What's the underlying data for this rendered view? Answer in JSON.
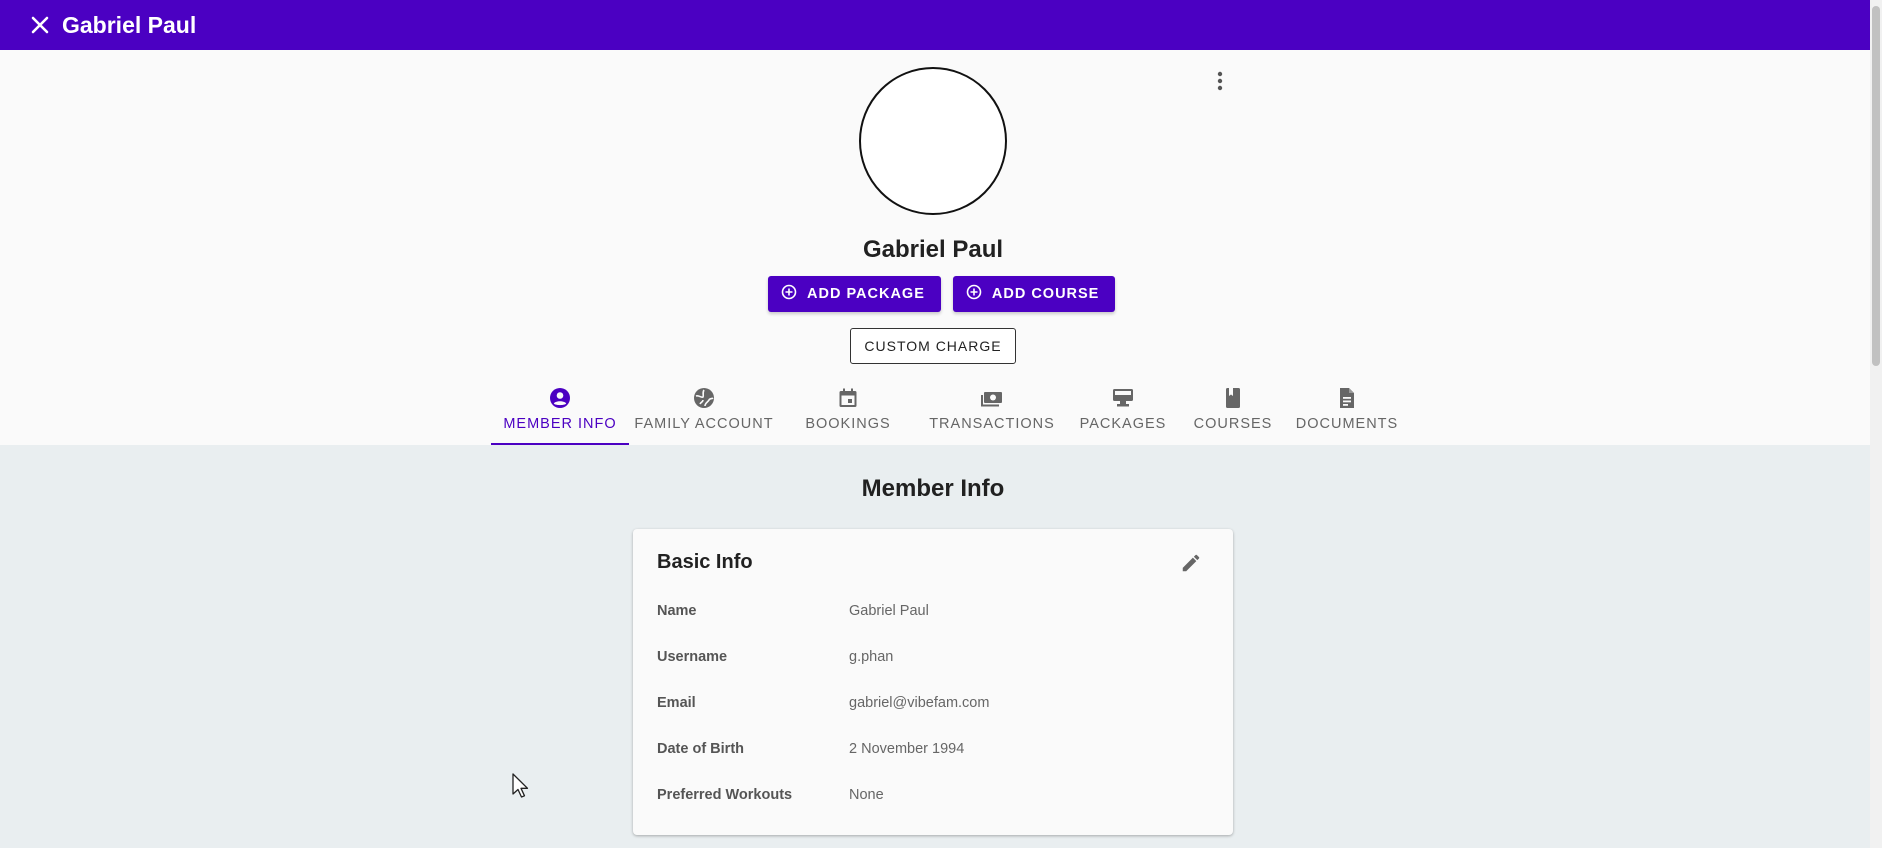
{
  "topbar": {
    "title": "Gabriel Paul",
    "close_icon": "close-icon",
    "bg": "#4b00c2"
  },
  "profile": {
    "name": "Gabriel Paul",
    "add_package_label": "ADD PACKAGE",
    "add_course_label": "ADD COURSE",
    "custom_charge_label": "CUSTOM CHARGE",
    "more_icon": "more-vert-icon"
  },
  "tabs": [
    {
      "label": "MEMBER INFO",
      "icon": "account-circle-icon",
      "active": true
    },
    {
      "label": "FAMILY ACCOUNT",
      "icon": "globe-icon",
      "active": false
    },
    {
      "label": "BOOKINGS",
      "icon": "calendar-icon",
      "active": false
    },
    {
      "label": "TRANSACTIONS",
      "icon": "cash-icon",
      "active": false
    },
    {
      "label": "PACKAGES",
      "icon": "package-icon",
      "active": false
    },
    {
      "label": "COURSES",
      "icon": "book-icon",
      "active": false
    },
    {
      "label": "DOCUMENTS",
      "icon": "document-icon",
      "active": false
    }
  ],
  "member_info": {
    "title": "Member Info",
    "card": {
      "title": "Basic Info",
      "fields": [
        {
          "label": "Name",
          "value": "Gabriel Paul"
        },
        {
          "label": "Username",
          "value": "g.phan"
        },
        {
          "label": "Email",
          "value": "gabriel@vibefam.com"
        },
        {
          "label": "Date of Birth",
          "value": "2 November 1994"
        },
        {
          "label": "Preferred Workouts",
          "value": "None"
        }
      ]
    }
  }
}
